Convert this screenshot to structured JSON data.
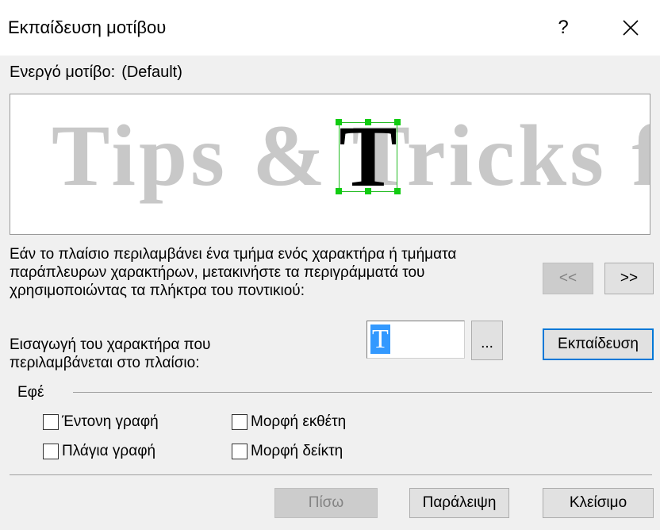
{
  "window": {
    "title": "Εκπαίδευση μοτίβου",
    "help_label": "?",
    "close_icon": "close-icon"
  },
  "active_pattern": {
    "label": "Ενεργό μοτίβο:",
    "value": "(Default)"
  },
  "preview": {
    "text": "Tips & Tricks fo",
    "highlighted_glyph": "T",
    "frame_color": "#22bb22"
  },
  "instructions": "Εάν το πλαίσιο περιλαμβάνει ένα τμήμα ενός χαρακτήρα ή τμήματα παράπλευρων χαρακτήρων, μετακινήστε τα περιγράμματά του χρησιμοποιώντας τα πλήκτρα του ποντικιού:",
  "nav": {
    "prev_label": "<<",
    "next_label": ">>"
  },
  "char_entry": {
    "label_line1": "Εισαγωγή του χαρακτήρα που",
    "label_line2": "περιλαμβάνεται στο πλαίσιο:",
    "value": "T",
    "browse_label": "...",
    "train_label": "Εκπαίδευση"
  },
  "effects": {
    "title": "Εφέ",
    "bold": "Έντονη γραφή",
    "italic": "Πλάγια γραφή",
    "superscript": "Μορφή εκθέτη",
    "subscript": "Μορφή δείκτη"
  },
  "footer": {
    "back_label": "Πίσω",
    "skip_label": "Παράλειψη",
    "close_label": "Κλείσιμο"
  },
  "colors": {
    "accent": "#0078d7",
    "selection": "#3399ff"
  }
}
